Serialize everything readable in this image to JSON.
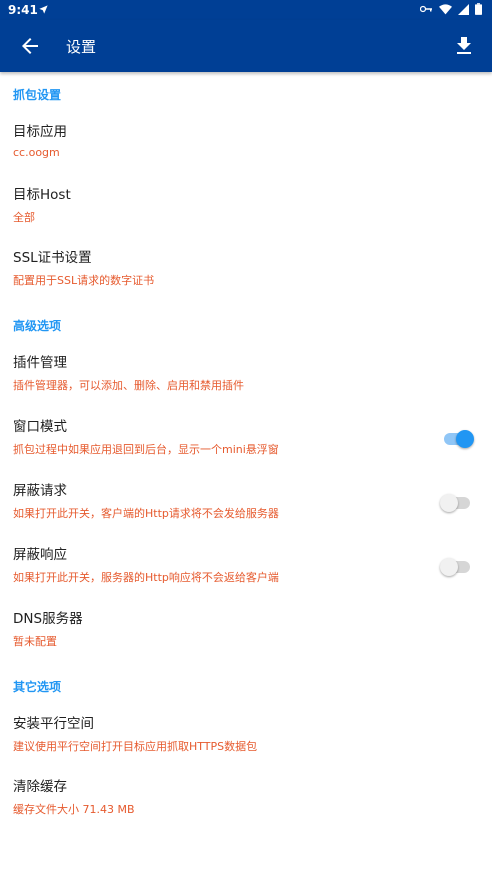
{
  "statusbar": {
    "time": "9:41"
  },
  "appbar": {
    "title": "设置"
  },
  "sections": {
    "capture": {
      "header": "抓包设置",
      "target_app": {
        "title": "目标应用",
        "summary": "cc.oogm"
      },
      "target_host": {
        "title": "目标Host",
        "summary": "全部"
      },
      "ssl_cert": {
        "title": "SSL证书设置",
        "summary": "配置用于SSL请求的数字证书"
      }
    },
    "advanced": {
      "header": "高级选项",
      "plugins": {
        "title": "插件管理",
        "summary": "插件管理器，可以添加、删除、启用和禁用插件"
      },
      "window_mode": {
        "title": "窗口模式",
        "summary": "抓包过程中如果应用退回到后台，显示一个mini悬浮窗",
        "enabled": true
      },
      "block_request": {
        "title": "屏蔽请求",
        "summary": "如果打开此开关，客户端的Http请求将不会发给服务器",
        "enabled": false
      },
      "block_response": {
        "title": "屏蔽响应",
        "summary": "如果打开此开关，服务器的Http响应将不会返给客户端",
        "enabled": false
      },
      "dns": {
        "title": "DNS服务器",
        "summary": "暂未配置"
      }
    },
    "other": {
      "header": "其它选项",
      "parallel_space": {
        "title": "安装平行空间",
        "summary": "建议使用平行空间打开目标应用抓取HTTPS数据包"
      },
      "clear_cache": {
        "title": "清除缓存",
        "summary": "缓存文件大小 71.43 MB"
      }
    }
  },
  "colors": {
    "primary": "#003f95",
    "accent": "#2196f3",
    "summary": "#e65a2e"
  }
}
